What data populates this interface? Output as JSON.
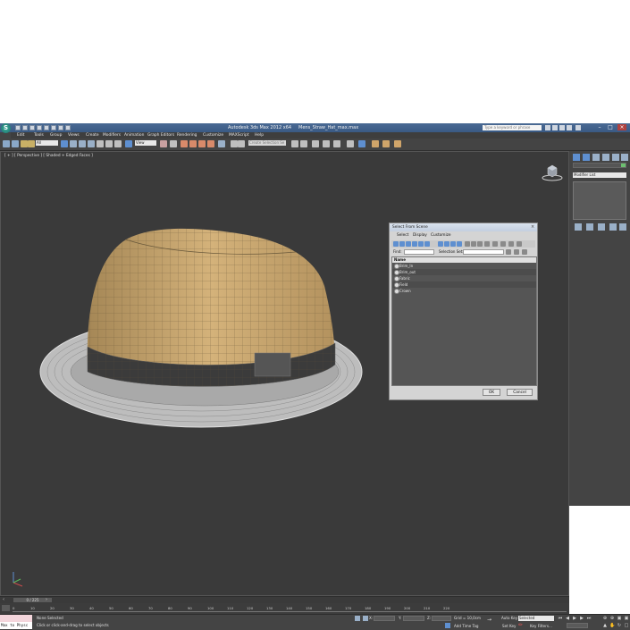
{
  "titlebar": {
    "app_title": "Autodesk 3ds Max 2012 x64",
    "file_name": "Mens_Straw_Hat_max.max",
    "search_placeholder": "Type a keyword or phrase",
    "logo": "3ds-max-logo"
  },
  "menubar": {
    "items": [
      "Edit",
      "Tools",
      "Group",
      "Views",
      "Create",
      "Modifiers",
      "Animation",
      "Graph Editors",
      "Rendering",
      "Customize",
      "MAXScript",
      "Help"
    ]
  },
  "toolbar": {
    "selection_filter": "All",
    "reference_coord": "View",
    "named_selection_placeholder": "Create Selection Se"
  },
  "viewport": {
    "label": "[ + ] [ Perspective ] [ Shaded + Edged Faces ]",
    "hat_colors": {
      "straw": "#c8a56d",
      "band": "#3a3a3a",
      "brim_wire": "#c9c9c9"
    }
  },
  "command_panel": {
    "modifier_list": "Modifier List"
  },
  "select_dialog": {
    "title": "Select From Scene",
    "menu": [
      "Select",
      "Display",
      "Customize"
    ],
    "find_label": "Find:",
    "selection_set_label": "Selection Set:",
    "column_header": "Name",
    "objects": [
      "Brim_In",
      "Brim_out",
      "Fabric",
      "Field",
      "Crown"
    ],
    "ok_label": "OK",
    "cancel_label": "Cancel"
  },
  "timeline": {
    "frame_readout": "0 / 225",
    "ticks": [
      "0",
      "10",
      "20",
      "30",
      "40",
      "50",
      "60",
      "70",
      "80",
      "90",
      "100",
      "110",
      "120",
      "130",
      "140",
      "150",
      "160",
      "170",
      "180",
      "190",
      "200",
      "210",
      "220"
    ]
  },
  "statusbar": {
    "maxscript_text": "Max to Physc",
    "selection_status": "None Selected",
    "prompt": "Click or click-and-drag to select objects",
    "x_label": "X:",
    "y_label": "Y:",
    "z_label": "Z:",
    "grid": "Grid = 10,0cm",
    "auto_key": "Auto Key",
    "selected": "Selected",
    "set_key": "Set Key",
    "key_filters": "Key Filters...",
    "add_time_tag": "Add Time Tag"
  }
}
